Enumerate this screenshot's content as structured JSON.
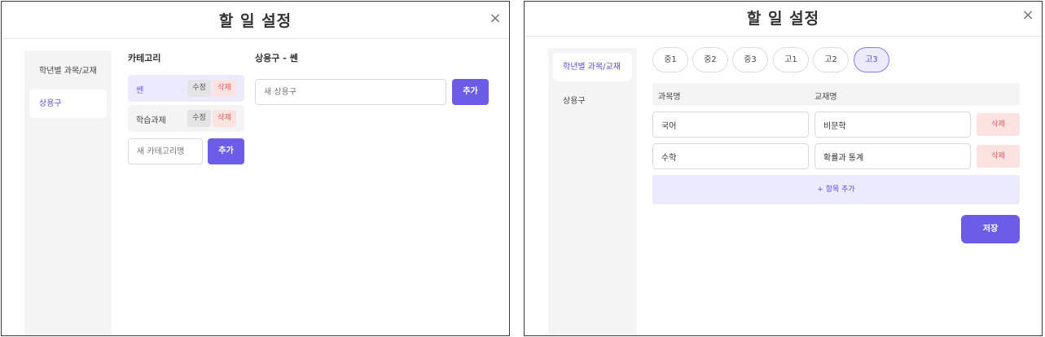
{
  "dialog_left": {
    "title": "할 일 설정",
    "close_label": "×",
    "sidebar": [
      {
        "label": "학년별 과목/교재"
      },
      {
        "label": "상용구"
      }
    ],
    "categories": {
      "heading": "카테고리",
      "items": [
        {
          "name": "쎈",
          "edit_label": "수정",
          "delete_label": "삭제"
        },
        {
          "name": "학습과제",
          "edit_label": "수정",
          "delete_label": "삭제"
        }
      ],
      "new_placeholder": "새 카테고리명",
      "add_label": "추가"
    },
    "phrases": {
      "heading": "상용구 - 쎈",
      "new_placeholder": "새 상용구",
      "add_label": "추가"
    }
  },
  "dialog_right": {
    "title": "할 일 설정",
    "close_label": "×",
    "sidebar": [
      {
        "label": "학년별 과목/교재"
      },
      {
        "label": "상용구"
      }
    ],
    "grade_tabs": [
      "중1",
      "중2",
      "중3",
      "고1",
      "고2",
      "고3"
    ],
    "active_grade": "고3",
    "table": {
      "col_subject": "과목명",
      "col_textbook": "교재명",
      "rows": [
        {
          "subject": "국어",
          "textbook": "비문학",
          "delete_label": "삭제"
        },
        {
          "subject": "수학",
          "textbook": "확률과 통계",
          "delete_label": "삭제"
        }
      ]
    },
    "add_item_label": "+ 항목 추가",
    "save_label": "저장"
  },
  "colors": {
    "accent": "#6c5ce7",
    "accent_light": "#ecebfd",
    "danger_text": "#e05757",
    "danger_bg": "#fde2e2",
    "sidebar_bg": "#f4f4f4"
  }
}
